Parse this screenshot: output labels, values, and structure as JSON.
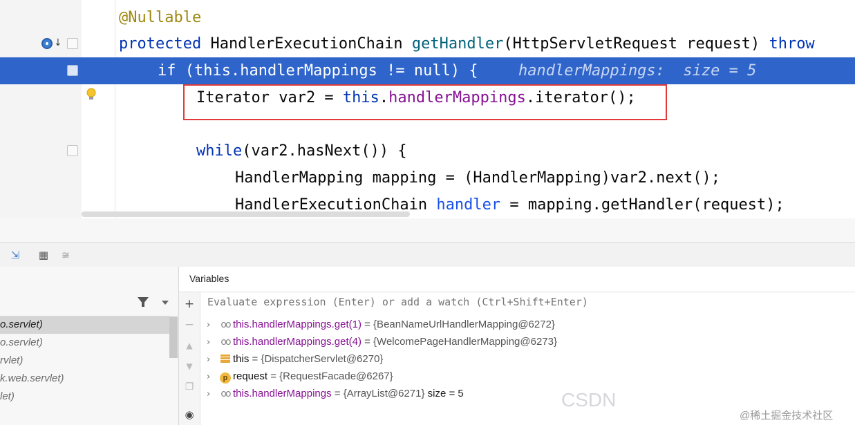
{
  "editor": {
    "lines": [
      {
        "annotation": "@Nullable"
      },
      {
        "kw": "protected",
        "type": "HandlerExecutionChain",
        "method": "getHandler",
        "params": "(HttpServletRequest request)",
        "throws": "throw"
      },
      {
        "pre": "if (",
        "this": "this",
        "field": ".handlerMappings",
        "post": " != null) {",
        "hint": "handlerMappings:  size = 5"
      },
      {
        "type": "Iterator var2 = ",
        "this": "this",
        "dot": ".",
        "field": "handlerMappings",
        "post": ".iterator();"
      },
      {
        "kw": "while",
        "post": "(var2.hasNext()) {"
      },
      {
        "text": "HandlerMapping mapping = (HandlerMapping)var2.next();"
      },
      {
        "pre": "HandlerExecutionChain ",
        "var": "handler",
        "post": " = mapping.getHandler(request);"
      }
    ]
  },
  "toolbar": {
    "icons": [
      "run-to-cursor-icon",
      "evaluate-table-icon",
      "trace-icon"
    ]
  },
  "frames": {
    "items": [
      "o.servlet)",
      "o.servlet)",
      "rvlet)",
      "k.web.servlet)",
      "let)"
    ],
    "selected_index": 0
  },
  "variables": {
    "title": "Variables",
    "eval_placeholder": "Evaluate expression (Enter) or add a watch (Ctrl+Shift+Enter)",
    "rows": [
      {
        "icon": "watch-icon",
        "name": "this.handlerMappings.get(1)",
        "value": " = {BeanNameUrlHandlerMapping@6272}"
      },
      {
        "icon": "watch-icon",
        "name": "this.handlerMappings.get(4)",
        "value": " = {WelcomePageHandlerMapping@6273}"
      },
      {
        "icon": "field-stack-icon",
        "name": "this",
        "value": " = {DispatcherServlet@6270}"
      },
      {
        "icon": "parameter-icon",
        "name": "request",
        "value": " = {RequestFacade@6267}"
      },
      {
        "icon": "watch-icon",
        "name": "this.handlerMappings",
        "value": " = {ArrayList@6271}",
        "extra": "  size = 5"
      }
    ]
  },
  "watermark": {
    "csdn": "CSDN",
    "site": "@稀土掘金技术社区"
  },
  "colors": {
    "highlight": "#2f65ca",
    "keyword": "#0033b3",
    "field": "#871094",
    "method": "#00627a",
    "annotation": "#9e880d",
    "redbox": "#e03a3a"
  }
}
